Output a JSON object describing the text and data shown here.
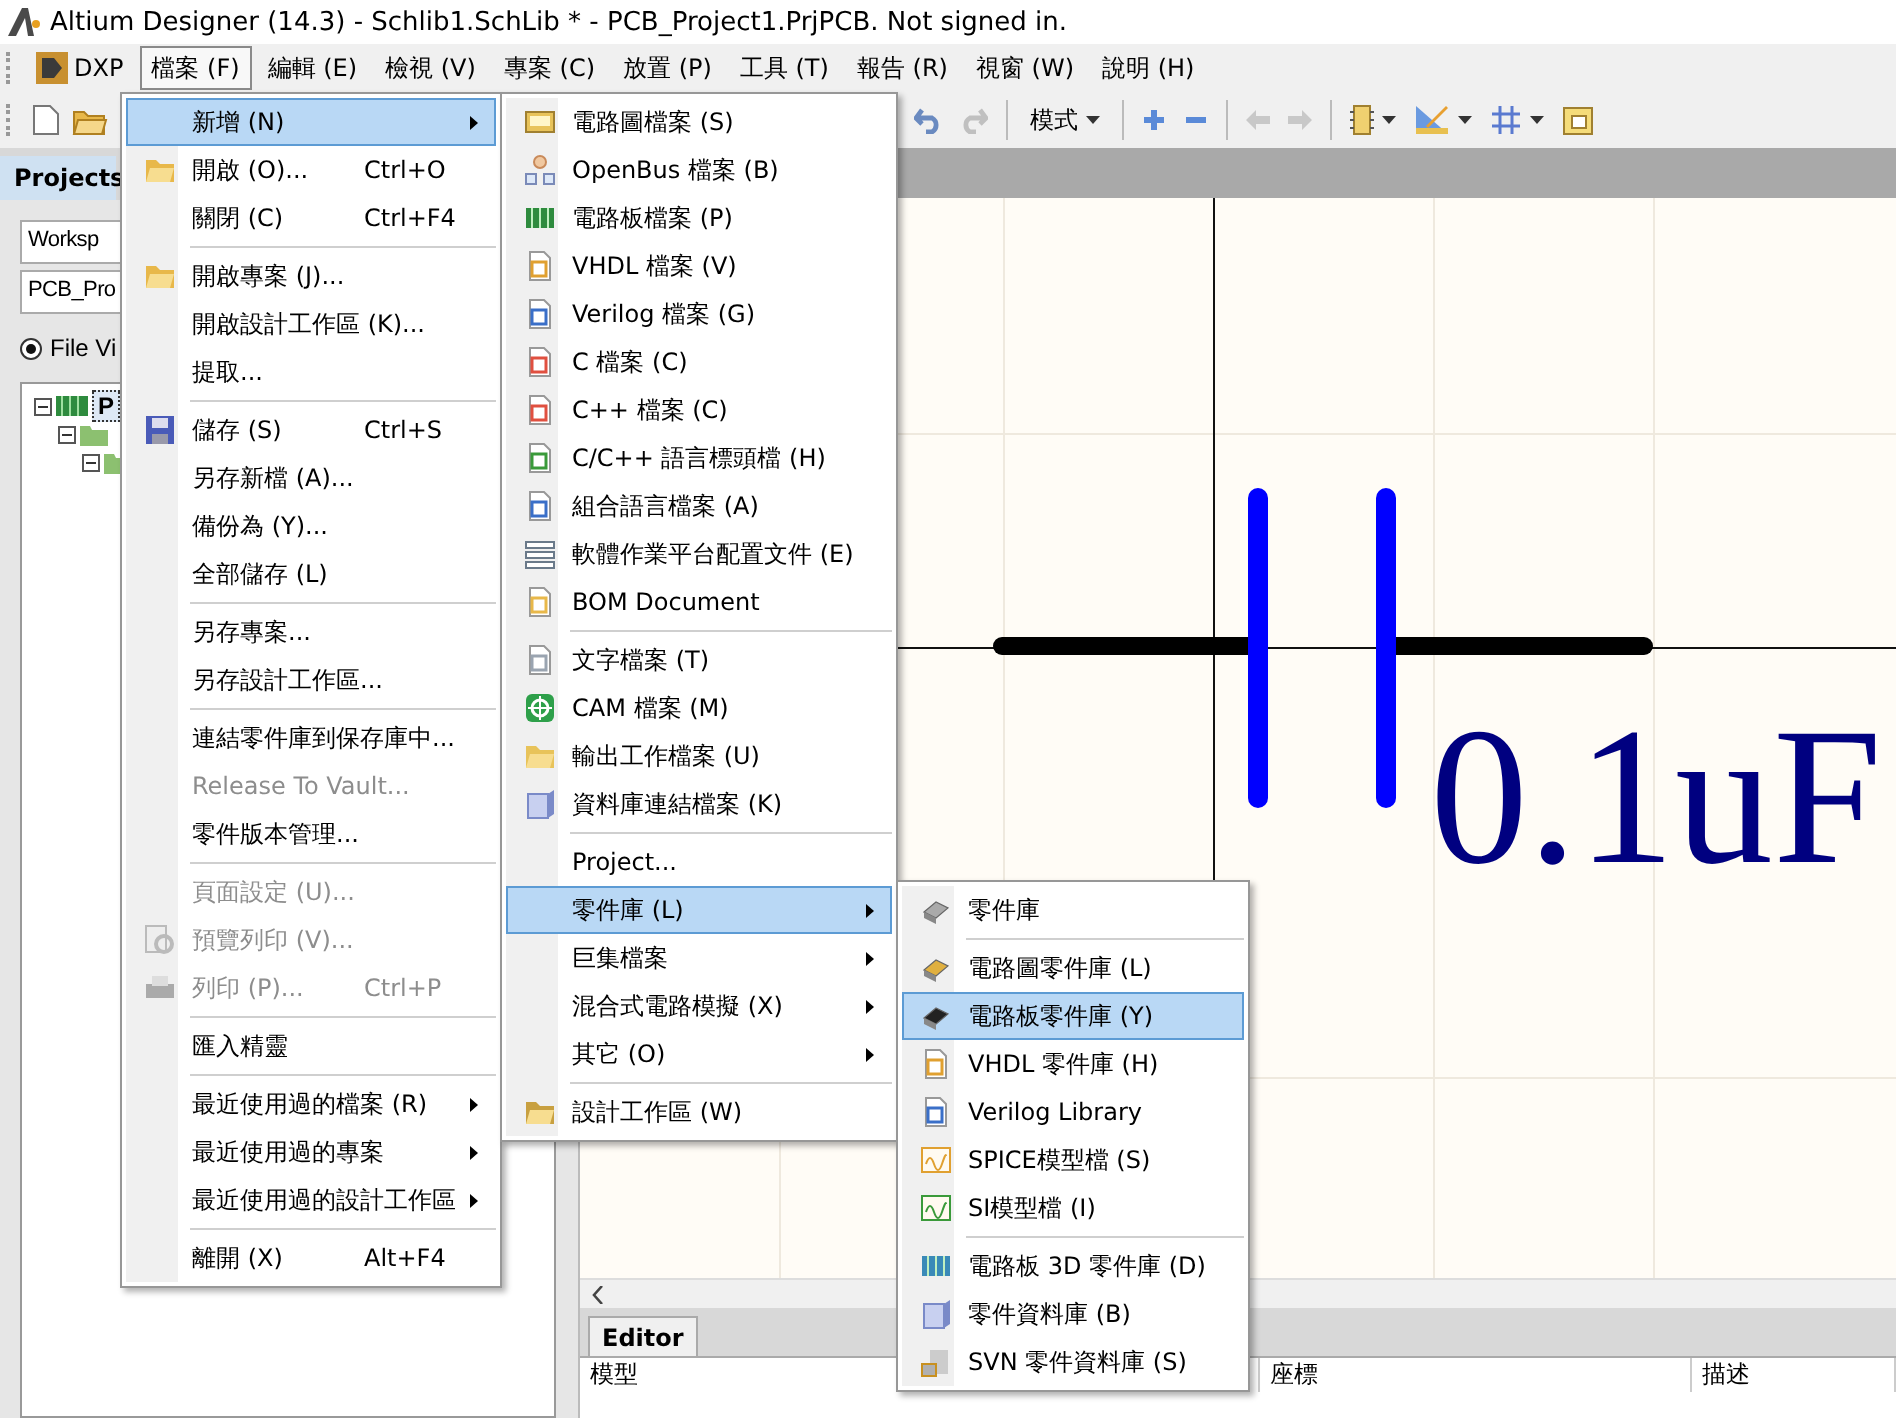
{
  "window": {
    "title": "Altium Designer (14.3) - Schlib1.SchLib * - PCB_Project1.PrjPCB. Not signed in."
  },
  "menubar": [
    {
      "label": "DXP",
      "selected": false
    },
    {
      "label": "檔案 (F)",
      "selected": true
    },
    {
      "label": "編輯 (E)",
      "selected": false
    },
    {
      "label": "檢視 (V)",
      "selected": false
    },
    {
      "label": "專案 (C)",
      "selected": false
    },
    {
      "label": "放置 (P)",
      "selected": false
    },
    {
      "label": "工具 (T)",
      "selected": false
    },
    {
      "label": "報告 (R)",
      "selected": false
    },
    {
      "label": "視窗 (W)",
      "selected": false
    },
    {
      "label": "說明 (H)",
      "selected": false
    }
  ],
  "toolbar": {
    "mode_button": "模式"
  },
  "projects_panel": {
    "tab": "Projects",
    "workspace_field": "Worksp",
    "project_field": "PCB_Pro",
    "view_radio": {
      "label": "File Vi",
      "checked": true
    },
    "tree": [
      {
        "label": "P",
        "selected": true,
        "expanded": true,
        "children": [
          {
            "expanded": true,
            "children": [
              {
                "expanded": true
              }
            ]
          }
        ]
      }
    ]
  },
  "schematic": {
    "value_label": "0.1uF"
  },
  "editor_panel": {
    "tab": "Editor",
    "columns": [
      "模型",
      "座標",
      "描述"
    ]
  },
  "menus": [
    {
      "items": [
        {
          "kind": "submenu",
          "label": "新增 (N)",
          "selected": true,
          "disabled": false
        },
        {
          "kind": "item",
          "label": "開啟 (O)...",
          "shortcut": "Ctrl+O",
          "selected": false,
          "disabled": false
        },
        {
          "kind": "item",
          "label": "關閉 (C)",
          "shortcut": "Ctrl+F4",
          "selected": false,
          "disabled": false
        },
        {
          "kind": "separator"
        },
        {
          "kind": "item",
          "label": "開啟專案 (J)...",
          "selected": false,
          "disabled": false
        },
        {
          "kind": "item",
          "label": "開啟設計工作區 (K)...",
          "selected": false,
          "disabled": false
        },
        {
          "kind": "item",
          "label": "提取...",
          "selected": false,
          "disabled": false
        },
        {
          "kind": "separator"
        },
        {
          "kind": "item",
          "label": "儲存 (S)",
          "shortcut": "Ctrl+S",
          "selected": false,
          "disabled": false
        },
        {
          "kind": "item",
          "label": "另存新檔 (A)...",
          "selected": false,
          "disabled": false
        },
        {
          "kind": "item",
          "label": "備份為 (Y)...",
          "selected": false,
          "disabled": false
        },
        {
          "kind": "item",
          "label": "全部儲存 (L)",
          "selected": false,
          "disabled": false
        },
        {
          "kind": "separator"
        },
        {
          "kind": "item",
          "label": "另存專案...",
          "selected": false,
          "disabled": false
        },
        {
          "kind": "item",
          "label": "另存設計工作區...",
          "selected": false,
          "disabled": false
        },
        {
          "kind": "separator"
        },
        {
          "kind": "item",
          "label": "連結零件庫到保存庫中...",
          "selected": false,
          "disabled": false
        },
        {
          "kind": "item",
          "label": "Release To Vault...",
          "selected": false,
          "disabled": true
        },
        {
          "kind": "item",
          "label": "零件版本管理...",
          "selected": false,
          "disabled": false
        },
        {
          "kind": "separator"
        },
        {
          "kind": "item",
          "label": "頁面設定 (U)...",
          "selected": false,
          "disabled": true
        },
        {
          "kind": "item",
          "label": "預覽列印 (V)...",
          "selected": false,
          "disabled": true
        },
        {
          "kind": "item",
          "label": "列印 (P)...",
          "shortcut": "Ctrl+P",
          "selected": false,
          "disabled": true
        },
        {
          "kind": "separator"
        },
        {
          "kind": "item",
          "label": "匯入精靈",
          "selected": false,
          "disabled": false
        },
        {
          "kind": "separator"
        },
        {
          "kind": "submenu",
          "label": "最近使用過的檔案 (R)",
          "selected": false,
          "disabled": false
        },
        {
          "kind": "submenu",
          "label": "最近使用過的專案",
          "selected": false,
          "disabled": false
        },
        {
          "kind": "submenu",
          "label": "最近使用過的設計工作區",
          "selected": false,
          "disabled": false
        },
        {
          "kind": "separator"
        },
        {
          "kind": "item",
          "label": "離開 (X)",
          "shortcut": "Alt+F4",
          "selected": false,
          "disabled": false
        }
      ]
    },
    {
      "items": [
        {
          "kind": "item",
          "label": "電路圖檔案 (S)",
          "selected": false
        },
        {
          "kind": "item",
          "label": "OpenBus 檔案 (B)",
          "selected": false
        },
        {
          "kind": "item",
          "label": "電路板檔案 (P)",
          "selected": false
        },
        {
          "kind": "item",
          "label": "VHDL 檔案 (V)",
          "selected": false
        },
        {
          "kind": "item",
          "label": "Verilog 檔案 (G)",
          "selected": false
        },
        {
          "kind": "item",
          "label": "C 檔案 (C)",
          "selected": false
        },
        {
          "kind": "item",
          "label": "C++ 檔案 (C)",
          "selected": false
        },
        {
          "kind": "item",
          "label": "C/C++ 語言標頭檔 (H)",
          "selected": false
        },
        {
          "kind": "item",
          "label": "組合語言檔案 (A)",
          "selected": false
        },
        {
          "kind": "item",
          "label": "軟體作業平台配置文件 (E)",
          "selected": false
        },
        {
          "kind": "item",
          "label": "BOM Document",
          "selected": false
        },
        {
          "kind": "separator"
        },
        {
          "kind": "item",
          "label": "文字檔案 (T)",
          "selected": false
        },
        {
          "kind": "item",
          "label": "CAM 檔案 (M)",
          "selected": false
        },
        {
          "kind": "item",
          "label": "輸出工作檔案 (U)",
          "selected": false
        },
        {
          "kind": "item",
          "label": "資料庫連結檔案 (K)",
          "selected": false
        },
        {
          "kind": "separator"
        },
        {
          "kind": "item",
          "label": "Project...",
          "selected": false
        },
        {
          "kind": "submenu",
          "label": "零件庫 (L)",
          "selected": true
        },
        {
          "kind": "submenu",
          "label": "巨集檔案",
          "selected": false
        },
        {
          "kind": "submenu",
          "label": "混合式電路模擬 (X)",
          "selected": false
        },
        {
          "kind": "submenu",
          "label": "其它 (O)",
          "selected": false
        },
        {
          "kind": "separator"
        },
        {
          "kind": "item",
          "label": "設計工作區 (W)",
          "selected": false
        }
      ]
    },
    {
      "items": [
        {
          "kind": "item",
          "label": "零件庫",
          "selected": false
        },
        {
          "kind": "separator"
        },
        {
          "kind": "item",
          "label": "電路圖零件庫 (L)",
          "selected": false
        },
        {
          "kind": "item",
          "label": "電路板零件庫 (Y)",
          "selected": true
        },
        {
          "kind": "item",
          "label": "VHDL 零件庫 (H)",
          "selected": false
        },
        {
          "kind": "item",
          "label": "Verilog Library",
          "selected": false
        },
        {
          "kind": "item",
          "label": "SPICE模型檔 (S)",
          "selected": false
        },
        {
          "kind": "item",
          "label": "SI模型檔 (I)",
          "selected": false
        },
        {
          "kind": "separator"
        },
        {
          "kind": "item",
          "label": "電路板 3D 零件庫 (D)",
          "selected": false
        },
        {
          "kind": "item",
          "label": "零件資料庫 (B)",
          "selected": false
        },
        {
          "kind": "item",
          "label": "SVN 零件資料庫 (S)",
          "selected": false
        }
      ]
    }
  ]
}
